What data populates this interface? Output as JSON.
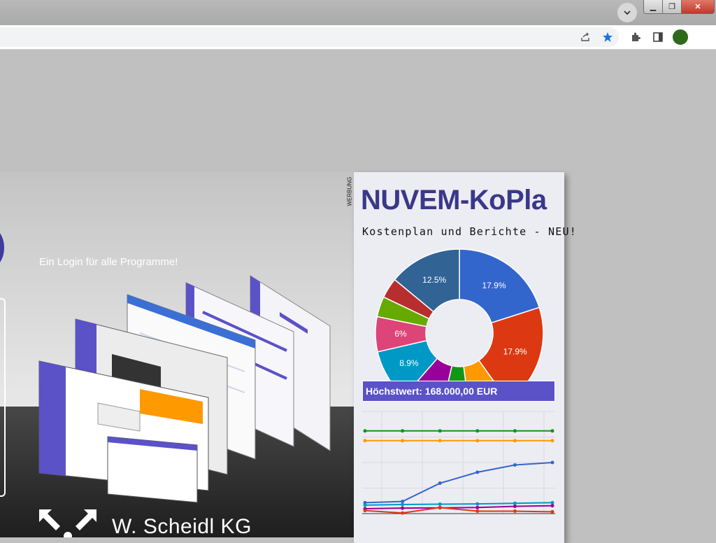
{
  "browser": {
    "window_controls": {
      "minimize": "▁",
      "maximize": "❐",
      "close": "✕"
    },
    "toolbar_icons": [
      "share-icon",
      "bookmark-star-icon",
      "extensions-icon",
      "side-panel-icon"
    ]
  },
  "hero": {
    "tagline": "Ein Login für alle Programme!",
    "company": "W. Scheidl KG"
  },
  "ad": {
    "label": "WERBUNG",
    "title": "NUVEM-KoPla",
    "subtitle": "Kostenplan und Berichte - NEU!",
    "max_value": "Höchstwert: 168.000,00 EUR"
  },
  "chart_data": [
    {
      "type": "pie",
      "donut": true,
      "slices": [
        {
          "value": 17.9,
          "label": "17.9%",
          "color": "#3366cc"
        },
        {
          "value": 17.9,
          "label": "17.9%",
          "color": "#dc3912"
        },
        {
          "value": 7.0,
          "label": "",
          "color": "#ff9900"
        },
        {
          "value": 5.0,
          "label": "",
          "color": "#109618"
        },
        {
          "value": 7.0,
          "label": "",
          "color": "#990099"
        },
        {
          "value": 8.9,
          "label": "8.9%",
          "color": "#0099c6"
        },
        {
          "value": 6.0,
          "label": "6%",
          "color": "#dd4477"
        },
        {
          "value": 3.5,
          "label": "",
          "color": "#66aa00"
        },
        {
          "value": 3.5,
          "label": "",
          "color": "#b82e2e"
        },
        {
          "value": 12.5,
          "label": "12.5%",
          "color": "#316395"
        }
      ]
    },
    {
      "type": "line",
      "ylim": [
        0,
        168000
      ],
      "grid": true,
      "series": [
        {
          "color": "#3366cc",
          "values": [
            18000,
            20000,
            50000,
            68000,
            80000,
            84000
          ]
        },
        {
          "color": "#0099c6",
          "values": [
            14000,
            15000,
            15500,
            16000,
            17000,
            18000
          ]
        },
        {
          "color": "#990099",
          "values": [
            8000,
            9000,
            9500,
            10000,
            12000,
            13000
          ]
        },
        {
          "color": "#dc3912",
          "values": [
            5000,
            1000,
            10000,
            4000,
            4000,
            3000
          ]
        },
        {
          "color": "#ff9900",
          "values": [
            120000,
            120000,
            120000,
            120000,
            120000,
            120000
          ]
        },
        {
          "color": "#109618",
          "values": [
            136000,
            136000,
            136000,
            136000,
            136000,
            136000
          ]
        }
      ]
    }
  ]
}
